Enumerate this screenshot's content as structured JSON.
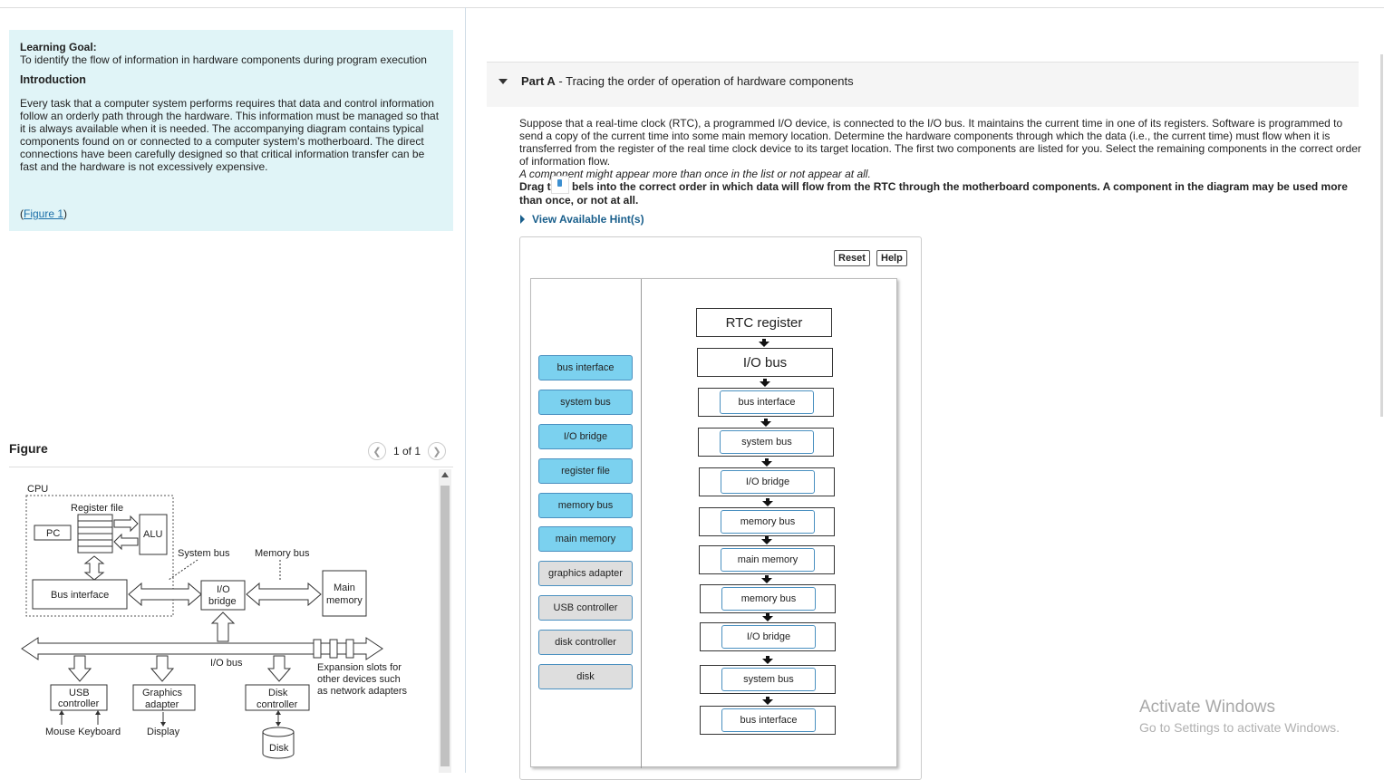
{
  "intro": {
    "learning_goal_label": "Learning Goal:",
    "learning_goal_text": "To identify the flow of information in hardware components during program execution",
    "introduction_heading": "Introduction",
    "introduction_text": "Every task that a computer system performs requires that data and control information follow an orderly path through the hardware. This information must be managed so that it is always available when it is needed. The accompanying diagram contains typical components found on or connected to a computer system's motherboard. The direct connections have been carefully designed so that critical information transfer can be fast and the hardware is not excessively expensive.",
    "figure_link_open": "(",
    "figure_link_text": "Figure 1",
    "figure_link_close": ")"
  },
  "figure_panel": {
    "title": "Figure",
    "pager_text": "1 of 1",
    "diagram_labels": {
      "cpu": "CPU",
      "register_file": "Register file",
      "pc": "PC",
      "alu": "ALU",
      "system_bus": "System bus",
      "memory_bus": "Memory bus",
      "bus_interface": "Bus interface",
      "io_bridge_1": "I/O",
      "io_bridge_2": "bridge",
      "main_memory_1": "Main",
      "main_memory_2": "memory",
      "io_bus": "I/O bus",
      "expansion_1": "Expansion slots for",
      "expansion_2": "other devices such",
      "expansion_3": "as network adapters",
      "usb_1": "USB",
      "usb_2": "controller",
      "graphics_1": "Graphics",
      "graphics_2": "adapter",
      "disk_ctrl_1": "Disk",
      "disk_ctrl_2": "controller",
      "mouse_keyboard": "Mouse Keyboard",
      "display": "Display",
      "disk": "Disk"
    }
  },
  "part_a": {
    "part_label": "Part A",
    "part_title": " - Tracing the order of operation of hardware components",
    "question_text": "Suppose that a real-time clock (RTC), a programmed I/O device, is connected to the I/O bus. It maintains the current time in one of its registers. Software is programmed to send a copy of the current time into some main memory location. Determine the hardware components through which the data (i.e., the current time) must flow when it is transferred from the register of the real time clock device to its target location. The first two components are listed for you. Select the remaining components in the correct order of information flow.",
    "question_italic": "A component might appear more than once in the list or not appear at all.",
    "instruction_prefix": "Drag t",
    "instruction_suffix": "bels into the correct order in which data will flow from the RTC through the motherboard components. A component in the diagram may be used more than once, or not at all.",
    "hints_label": "View Available Hint(s)",
    "reset_label": "Reset",
    "help_label": "Help",
    "label_bank": [
      {
        "label": "bus interface",
        "state": "available"
      },
      {
        "label": "system bus",
        "state": "available"
      },
      {
        "label": "I/O bridge",
        "state": "available"
      },
      {
        "label": "register file",
        "state": "available"
      },
      {
        "label": "memory bus",
        "state": "available"
      },
      {
        "label": "main memory",
        "state": "available"
      },
      {
        "label": "graphics adapter",
        "state": "unused"
      },
      {
        "label": "USB controller",
        "state": "unused"
      },
      {
        "label": "disk controller",
        "state": "unused"
      },
      {
        "label": "disk",
        "state": "unused"
      }
    ],
    "fixed_steps": [
      "RTC register",
      "I/O bus"
    ],
    "placed_steps": [
      "bus interface",
      "system bus",
      "I/O bridge",
      "memory bus",
      "main memory",
      "memory bus",
      "I/O bridge",
      "system bus",
      "bus interface"
    ]
  },
  "watermark": {
    "line1": "Activate Windows",
    "line2": "Go to Settings to activate Windows."
  },
  "colors": {
    "info_bg": "#e0f4f7",
    "label_available": "#7bd1ef",
    "label_unused": "#dedede",
    "link": "#1a6ea8"
  }
}
